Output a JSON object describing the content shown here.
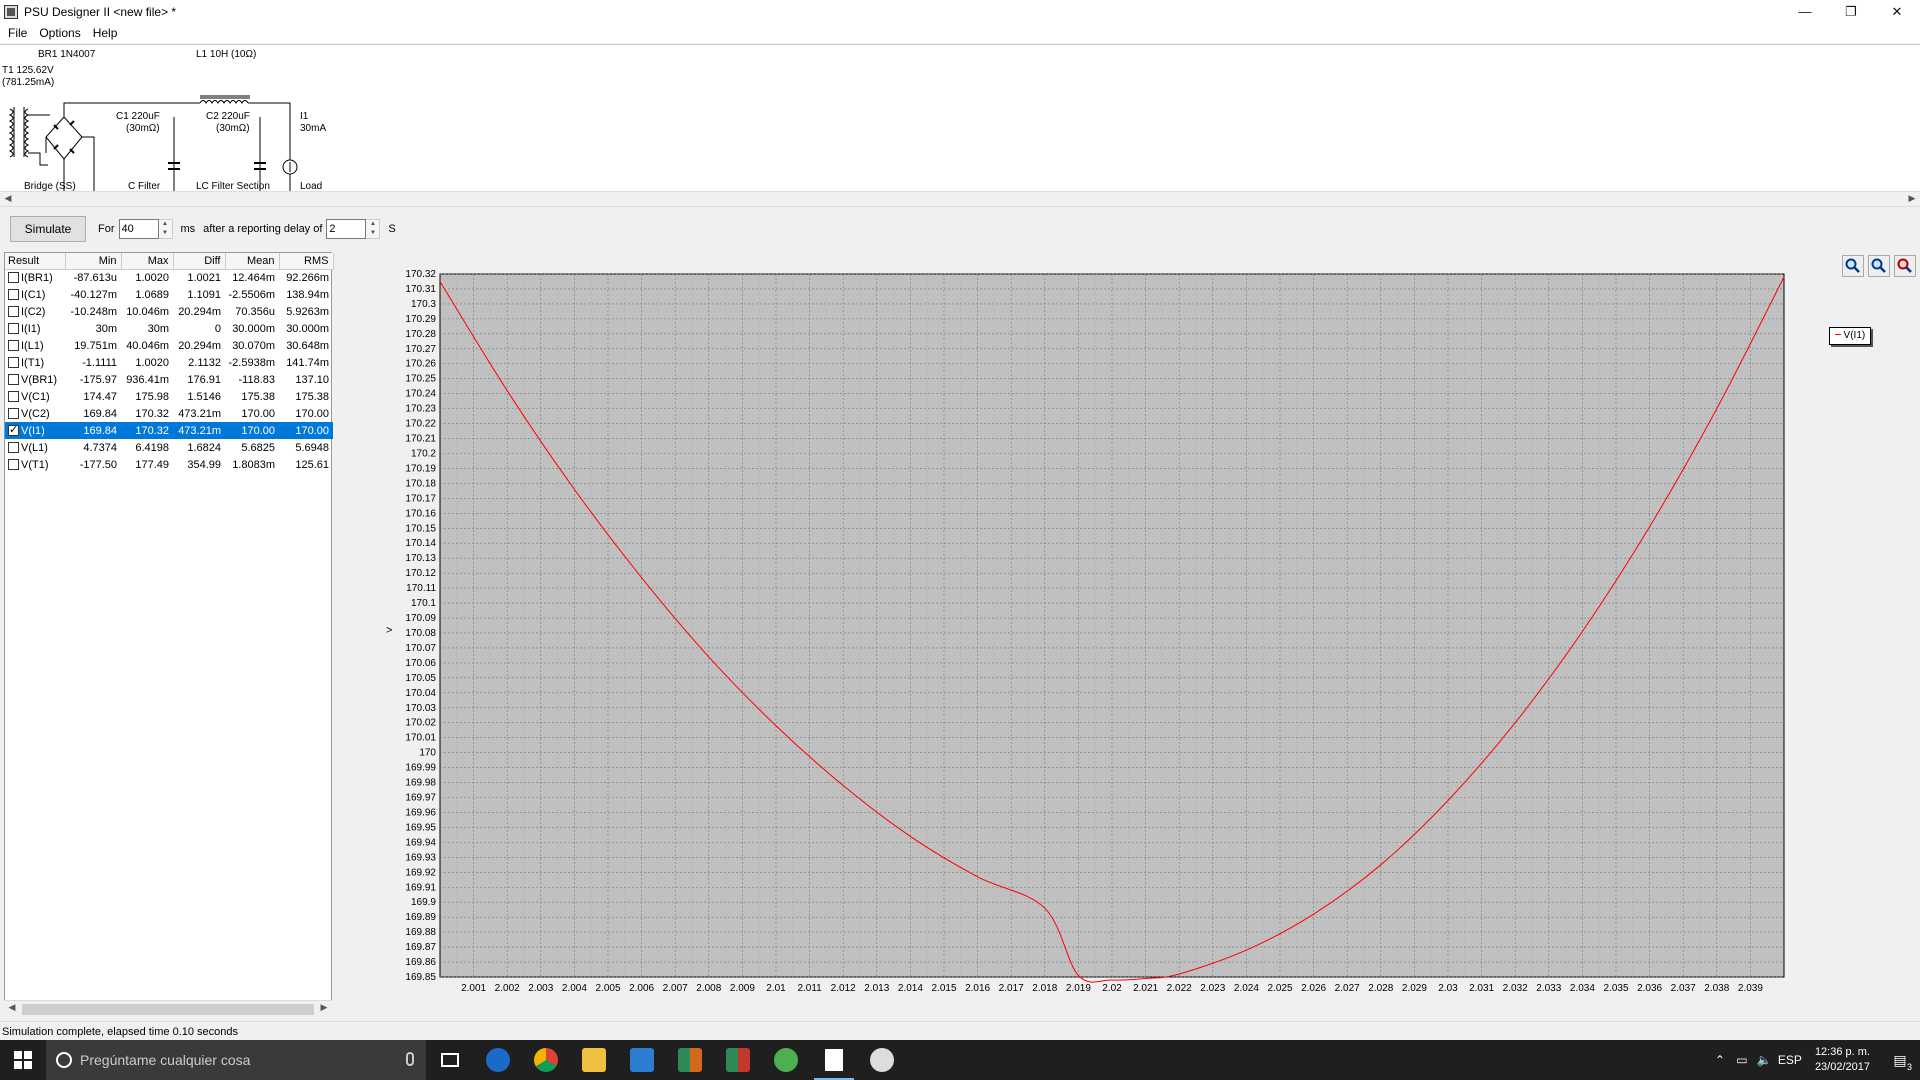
{
  "window": {
    "title": "PSU Designer II  <new file> *",
    "minimize_glyph": "—",
    "maximize_glyph": "❐",
    "close_glyph": "✕"
  },
  "menu": [
    "File",
    "Options",
    "Help"
  ],
  "schematic": {
    "t1_label": "T1 125.62V",
    "t1_sub": "(781.25mA)",
    "br1_label": "BR1 1N4007",
    "l1_label": "L1 10H (10Ω)",
    "c1_label": "C1 220uF",
    "c1_sub": "(30mΩ)",
    "c2_label": "C2 220uF",
    "c2_sub": "(30mΩ)",
    "i1_label": "I1",
    "i1_sub": "30mA",
    "sections": [
      "Bridge (SS)",
      "C Filter",
      "LC Filter Section",
      "Load"
    ]
  },
  "toolbar": {
    "simulate_label": "Simulate",
    "for_label": "For",
    "duration_value": "40",
    "ms_label": "ms",
    "delay_label": "after a reporting delay of",
    "delay_value": "2",
    "s_label": "S"
  },
  "results": {
    "columns": [
      "Result",
      "Min",
      "Max",
      "Diff",
      "Mean",
      "RMS"
    ],
    "rows": [
      {
        "name": "I(BR1)",
        "min": "-87.613u",
        "max": "1.0020",
        "diff": "1.0021",
        "mean": "12.464m",
        "rms": "92.266m",
        "checked": false
      },
      {
        "name": "I(C1)",
        "min": "-40.127m",
        "max": "1.0689",
        "diff": "1.1091",
        "mean": "-2.5506m",
        "rms": "138.94m",
        "checked": false
      },
      {
        "name": "I(C2)",
        "min": "-10.248m",
        "max": "10.046m",
        "diff": "20.294m",
        "mean": "70.356u",
        "rms": "5.9263m",
        "checked": false
      },
      {
        "name": "I(I1)",
        "min": "30m",
        "max": "30m",
        "diff": "0",
        "mean": "30.000m",
        "rms": "30.000m",
        "checked": false
      },
      {
        "name": "I(L1)",
        "min": "19.751m",
        "max": "40.046m",
        "diff": "20.294m",
        "mean": "30.070m",
        "rms": "30.648m",
        "checked": false
      },
      {
        "name": "I(T1)",
        "min": "-1.1111",
        "max": "1.0020",
        "diff": "2.1132",
        "mean": "-2.5938m",
        "rms": "141.74m",
        "checked": false
      },
      {
        "name": "V(BR1)",
        "min": "-175.97",
        "max": "936.41m",
        "diff": "176.91",
        "mean": "-118.83",
        "rms": "137.10",
        "checked": false
      },
      {
        "name": "V(C1)",
        "min": "174.47",
        "max": "175.98",
        "diff": "1.5146",
        "mean": "175.38",
        "rms": "175.38",
        "checked": false
      },
      {
        "name": "V(C2)",
        "min": "169.84",
        "max": "170.32",
        "diff": "473.21m",
        "mean": "170.00",
        "rms": "170.00",
        "checked": false
      },
      {
        "name": "V(I1)",
        "min": "169.84",
        "max": "170.32",
        "diff": "473.21m",
        "mean": "170.00",
        "rms": "170.00",
        "checked": true
      },
      {
        "name": "V(L1)",
        "min": "4.7374",
        "max": "6.4198",
        "diff": "1.6824",
        "mean": "5.6825",
        "rms": "5.6948",
        "checked": false
      },
      {
        "name": "V(T1)",
        "min": "-177.50",
        "max": "177.49",
        "diff": "354.99",
        "mean": "1.8083m",
        "rms": "125.61",
        "checked": false
      }
    ]
  },
  "chart_data": {
    "type": "line",
    "title": "",
    "xlabel": "",
    "ylabel": "V",
    "xlim": [
      2.0,
      2.04
    ],
    "ylim": [
      169.85,
      170.32
    ],
    "x_ticks": [
      "2.001",
      "2.002",
      "2.003",
      "2.004",
      "2.005",
      "2.006",
      "2.007",
      "2.008",
      "2.009",
      "2.01",
      "2.011",
      "2.012",
      "2.013",
      "2.014",
      "2.015",
      "2.016",
      "2.017",
      "2.018",
      "2.019",
      "2.02",
      "2.021",
      "2.022",
      "2.023",
      "2.024",
      "2.025",
      "2.026",
      "2.027",
      "2.028",
      "2.029",
      "2.03",
      "2.031",
      "2.032",
      "2.033",
      "2.034",
      "2.035",
      "2.036",
      "2.037",
      "2.038",
      "2.039"
    ],
    "y_ticks": [
      "170.32",
      "170.31",
      "170.3",
      "170.29",
      "170.28",
      "170.27",
      "170.26",
      "170.25",
      "170.24",
      "170.23",
      "170.22",
      "170.21",
      "170.2",
      "170.19",
      "170.18",
      "170.17",
      "170.16",
      "170.15",
      "170.14",
      "170.13",
      "170.12",
      "170.11",
      "170.1",
      "170.09",
      "170.08",
      "170.07",
      "170.06",
      "170.05",
      "170.04",
      "170.03",
      "170.02",
      "170.01",
      "170",
      "169.99",
      "169.98",
      "169.97",
      "169.96",
      "169.95",
      "169.94",
      "169.93",
      "169.92",
      "169.91",
      "169.9",
      "169.89",
      "169.88",
      "169.87",
      "169.86",
      "169.85"
    ],
    "grid": true,
    "legend": "top-right",
    "series": [
      {
        "name": "V(I1)",
        "color": "#ff0000",
        "x": [
          2.0,
          2.002,
          2.004,
          2.006,
          2.008,
          2.01,
          2.012,
          2.014,
          2.016,
          2.018,
          2.019,
          2.02,
          2.021,
          2.022,
          2.024,
          2.026,
          2.028,
          2.03,
          2.032,
          2.034,
          2.036,
          2.038,
          2.04
        ],
        "y": [
          170.315,
          170.242,
          170.176,
          170.117,
          170.064,
          170.018,
          169.978,
          169.944,
          169.917,
          169.896,
          169.851,
          169.848,
          169.849,
          169.852,
          169.868,
          169.892,
          169.925,
          169.968,
          170.02,
          170.081,
          170.151,
          170.23,
          170.318
        ]
      }
    ]
  },
  "plot": {
    "background": "#c0c0c0",
    "y_axis_marker": ">"
  },
  "status": "Simulation complete, elapsed time 0.10 seconds",
  "taskbar": {
    "search_placeholder": "Pregúntame cualquier cosa",
    "lang": "ESP",
    "time": "12:36 p. m.",
    "date": "23/02/2017",
    "notif_count": "3"
  }
}
